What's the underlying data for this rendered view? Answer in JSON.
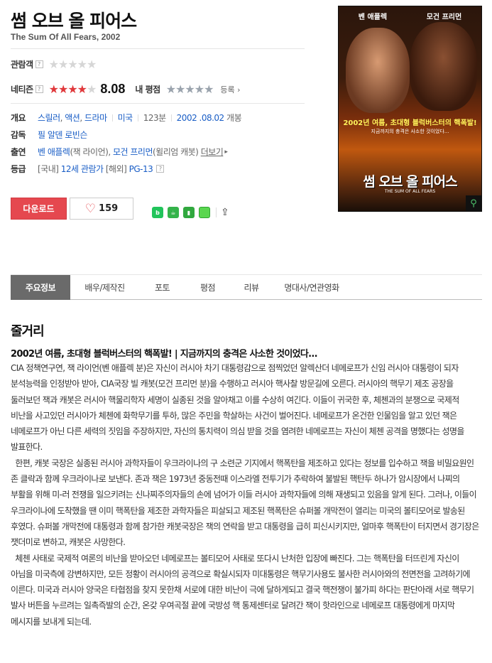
{
  "movie": {
    "title": "썸 오브 올 피어스",
    "original_title": "The Sum Of All Fears, 2002"
  },
  "ratings": {
    "audience_label": "관람객",
    "netizen_label": "네티즌",
    "netizen_score": "8.08",
    "netizen_stars": 4,
    "my_rating_label": "내 평점",
    "register_label": "등록",
    "help_glyph": "?"
  },
  "info": {
    "overview_label": "개요",
    "genres": [
      "스릴러",
      "액션",
      "드라마"
    ],
    "country": "미국",
    "runtime": "123분",
    "release_date": "2002 .08.02",
    "release_suffix": "개봉",
    "director_label": "감독",
    "director": "필 알덴 로빈슨",
    "cast_label": "출연",
    "cast": [
      {
        "name": "벤 애플렉",
        "role": "(잭 라이언)"
      },
      {
        "name": "모건 프리먼",
        "role": "(윌리엄 캐봇)"
      }
    ],
    "more_label": "더보기",
    "grade_label": "등급",
    "grade_domestic_prefix": "[국내]",
    "grade_domestic": "12세 관람가",
    "grade_overseas_prefix": "[해외]",
    "grade_overseas": "PG-13"
  },
  "actions": {
    "download_label": "다운로드",
    "like_count": "159"
  },
  "poster": {
    "actor_left": "벤 애플렉",
    "actor_right": "모건 프리먼",
    "tagline": "2002년 여름, 초대형 블럭버스터의 핵폭발!",
    "tagline_sub": "지금까지의 충격은 사소한 것이었다...",
    "title": "썸 오브 올 피어스",
    "title_en": "THE SUM OF ALL FEARS"
  },
  "tabs": [
    "주요정보",
    "배우/제작진",
    "포토",
    "평점",
    "리뷰",
    "명대사/연관영화"
  ],
  "plot": {
    "heading": "줄거리",
    "tagline": "2002년 여름, 초대형 블럭버스터의 핵폭발! | 지금까지의 충격은 사소한 것이었다...",
    "paragraphs": [
      "CIA 정책연구연, 잭 라이언(벤 애플렉 분)은 자신이 러시아 차기 대통령감으로 점찍었던 알렉산더 네메로프가 신임 러시아 대통령이 되자 분석능력을 인정받아 받아, CIA국장 빌 캐봇(모건 프리먼 분)을 수행하고 러시아 핵사찰 방문길에 오른다. 러시아의 핵무기 제조 공장을 둘러보던 잭과 캐봇은 러시아 핵물리학자 세명이 실종된 것을 알아채고 이를 수상히 여긴다. 이들이 귀국한 후, 체첸과의 분쟁으로 국제적 비난을 사고있던 러시아가 체첸에 화학무기를 투하, 많은 주민을 학살하는 사건이 벌어진다. 네메로프가 온건한 인물임을 알고 있던 잭은 네메로프가 아닌 다른 세력의 짓임을 주장하지만, 자신의 통치력이 의심 받을 것을 염려한 네메로프는 자신이 체첸 공격을 명했다는 성명을 발표한다.",
      "  한편, 캐봇 국장은 실종된 러시아 과학자들이 우크라이나의 구 소련군 기지에서 핵폭탄을 제조하고 있다는 정보를 입수하고 잭을 비밀요원인 존 클락과 함께 우크라이나로 보낸다. 존과 잭은 1973년 중동전때 이스라엘 전투기가 추락하여 불발된 핵탄두 하나가 암시장에서 나찌의 부활을 위해 미-러 전쟁을 일으키려는 신나찌주의자들의 손에 넘어가 이들 러시아 과학자들에 의해 재생되고 있음을 알게 된다. 그러나, 이들이 우크라이나에 도착했을 땐 이미 핵폭탄을 제조한 과학자들은 피살되고 제조된 핵폭탄은 슈퍼볼 개막전이 열리는 미국의 볼티모어로 발송된 후였다. 슈퍼볼 개막전에 대통령과 함께 참가한 캐봇국장은 잭의 연락을 받고 대통령을 급히 피신시키지만, 얼마후 핵폭탄이 터지면서 경기장은 잿더미로 변하고, 캐봇은 사망한다.",
      "  체첸 사태로 국제적 여론의 비난을 받아오던 네메로프는 볼티모어 사태로 또다시 난처한 입장에 빠진다. 그는 핵폭탄을 터뜨린게 자신이 아님을 미국측에 강변하지만, 모든 정황이 러시아의 공격으로 확실시되자 미대통령은 핵무기사용도 불사한 러시아와의 전면전을 고려하기에 이른다. 미국과 러시아 양국은 타협점을 찾지 못한채 서로에 대한 비난이 극에 달하게되고 결국 핵전쟁이 불가피 하다는 판단아래 서로 핵무기 발사 버튼을 누르려는 일촉즉발의 순간, 온갖 우여곡절 끝에 국방성 핵 통제센터로 달려간 잭이 핫라인으로 네메로프 대통령에게 마지막 메시지를 보내게 되는데."
    ]
  },
  "colors": {
    "accent_red": "#e5484f",
    "link_blue": "#1a5ec6",
    "tab_active": "#6a6a6a"
  }
}
